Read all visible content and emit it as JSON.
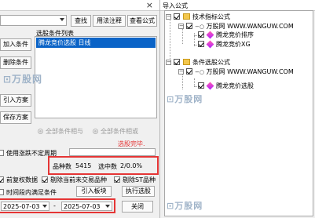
{
  "left_dialog": {
    "buttons": {
      "find": "查找",
      "view_formula_note": "用法注释",
      "view_formula": "查看公式",
      "add_condition": "加入条件",
      "delete_condition": "删除条件",
      "import_plan": "引入方案",
      "save_plan": "保存方案",
      "import_board": "引入板块",
      "execute_filter": "执行选股",
      "close": "关闭"
    },
    "list_label": "选股条件列表",
    "list_items": [
      "腾龙竞价选股  日线"
    ],
    "radio_all_and": "全部条件相与",
    "radio_all_or": "全部条件相或",
    "red_note": "选股完毕.",
    "cb_use_period": "使用涨跌不定周期",
    "stats": {
      "count_label": "品种数",
      "count_value": "5415",
      "selected_label": "选中数",
      "selected_value": "2/0.0%"
    },
    "cb_pre_adjust": "前复权数据",
    "cb_delete_untraded": "剔除当前未交易品种",
    "cb_delete_st": "剔除ST品种",
    "cb_time_range": "时间段内满足条件",
    "date_from": "2025-07-03",
    "date_sep": "-",
    "date_to": "2025-07-03",
    "watermark": "万股网"
  },
  "right_dialog": {
    "title": "导入公式",
    "tree": {
      "group1": "技术指标公式",
      "source1": "万股网 WWW.WANGUW.COM",
      "items1": [
        "腾龙竞价排序",
        "腾龙竞价XG"
      ],
      "group2": "条件选股公式",
      "source2": "万股网 WWW.WANGUW.COM",
      "items2": [
        "腾龙竞价选股"
      ]
    },
    "watermark": "万股网"
  },
  "colors": {
    "selection": "#0a63c7",
    "highlight_box": "#e53535",
    "note_red": "#e53535"
  }
}
